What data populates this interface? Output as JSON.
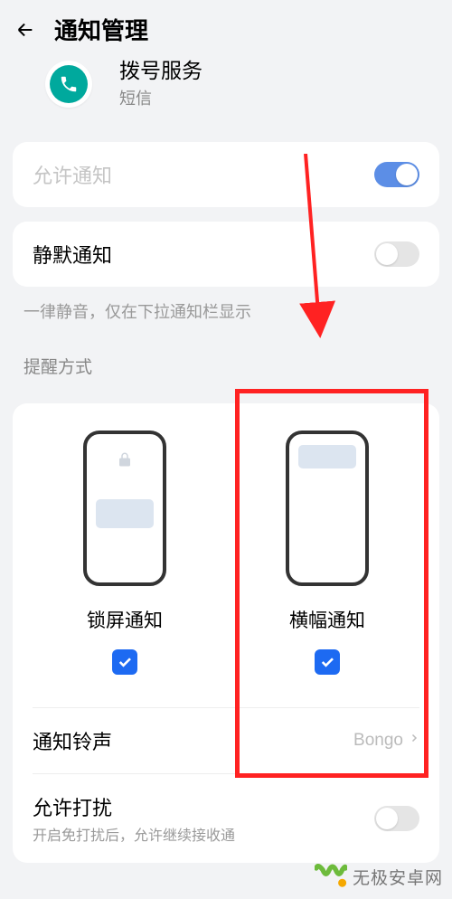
{
  "header": {
    "title": "通知管理"
  },
  "app": {
    "name": "拨号服务",
    "sub": "短信"
  },
  "allow": {
    "label": "允许通知",
    "state": true
  },
  "silent": {
    "label": "静默通知",
    "state": false,
    "hint": "一律静音，仅在下拉通知栏显示"
  },
  "alertSection": "提醒方式",
  "options": {
    "lock": "锁屏通知",
    "banner": "横幅通知"
  },
  "ringtone": {
    "label": "通知铃声",
    "value": "Bongo"
  },
  "dnd": {
    "label": "允许打扰",
    "sub": "开启免打扰后，允许继续接收通"
  },
  "watermark": "无极安卓网"
}
